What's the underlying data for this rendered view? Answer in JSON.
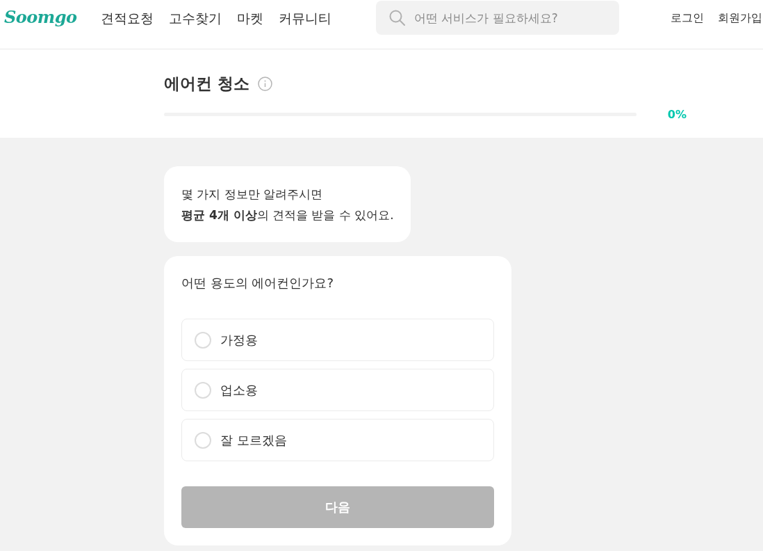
{
  "header": {
    "logo": "Soomgo",
    "nav": [
      "견적요청",
      "고수찾기",
      "마켓",
      "커뮤니티"
    ],
    "search": {
      "placeholder": "어떤 서비스가 필요하세요?"
    },
    "auth_links": [
      "로그인",
      "회원가입"
    ]
  },
  "request": {
    "title": "에어컨 청소",
    "progress": {
      "level": 0,
      "reading": "0%"
    }
  },
  "intro": {
    "lines": [
      "몇 가지 정보만 알려주시면",
      "**평균 4개 이상**의 견적을 받을 수 있어요."
    ]
  },
  "question": {
    "text": "어떤 용도의 에어컨인가요?",
    "options": [
      {
        "label": "가정용",
        "selected": false
      },
      {
        "label": "업소용",
        "selected": false
      },
      {
        "label": "잘 모르겠음",
        "selected": false
      }
    ],
    "next_button": {
      "label": "다음",
      "disabled": true
    }
  }
}
